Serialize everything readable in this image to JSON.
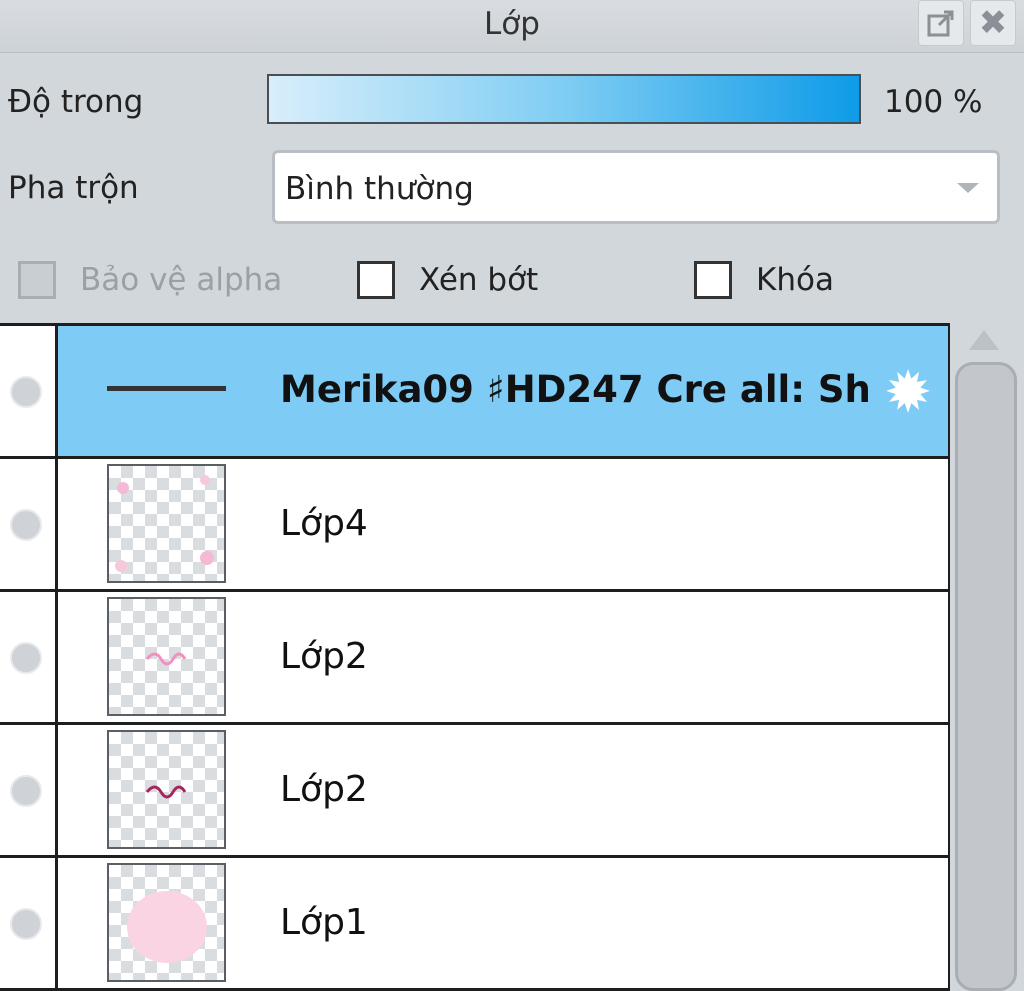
{
  "window": {
    "title": "Lớp"
  },
  "opacity": {
    "label": "Độ trong",
    "value": 1.0,
    "display": "100 %"
  },
  "blend": {
    "label": "Pha trộn",
    "selected": "Bình thường"
  },
  "checks": [
    {
      "label": "Bảo vệ alpha",
      "checked": false,
      "disabled": true
    },
    {
      "label": "Xén bớt",
      "checked": false,
      "disabled": false
    },
    {
      "label": "Khóa",
      "checked": false,
      "disabled": false
    }
  ],
  "layers": [
    {
      "name": "Merika09 ♯HD247 Cre all: Sh",
      "type": "folder",
      "selected": true,
      "thumb": "line"
    },
    {
      "name": "Lớp4",
      "type": "layer",
      "selected": false,
      "thumb": "corner-flowers"
    },
    {
      "name": "Lớp2",
      "type": "layer",
      "selected": false,
      "thumb": "pink-text-light"
    },
    {
      "name": "Lớp2",
      "type": "layer",
      "selected": false,
      "thumb": "pink-text-dark"
    },
    {
      "name": "Lớp1",
      "type": "layer",
      "selected": false,
      "thumb": "pink-blob"
    }
  ],
  "colors": {
    "selected_row": "#7ecbf5",
    "opacity_fill": "#0e9be8",
    "panel_bg": "#d2d7dc"
  },
  "icons": {
    "float": "popout-icon",
    "close": "close-icon",
    "settings": "gear-icon",
    "visibility": "eye-dot-icon"
  }
}
